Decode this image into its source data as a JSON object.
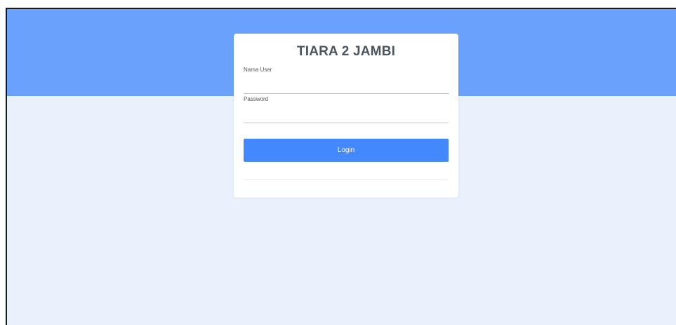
{
  "login": {
    "title": "TIARA 2 JAMBI",
    "username_label": "Nama User",
    "username_value": "",
    "password_label": "Password",
    "password_value": "",
    "submit_label": "Login"
  },
  "colors": {
    "hero_band": "#6aa1fd",
    "page_background": "#eaf1fd",
    "button": "#4388fd",
    "title_text": "#4a5560"
  }
}
